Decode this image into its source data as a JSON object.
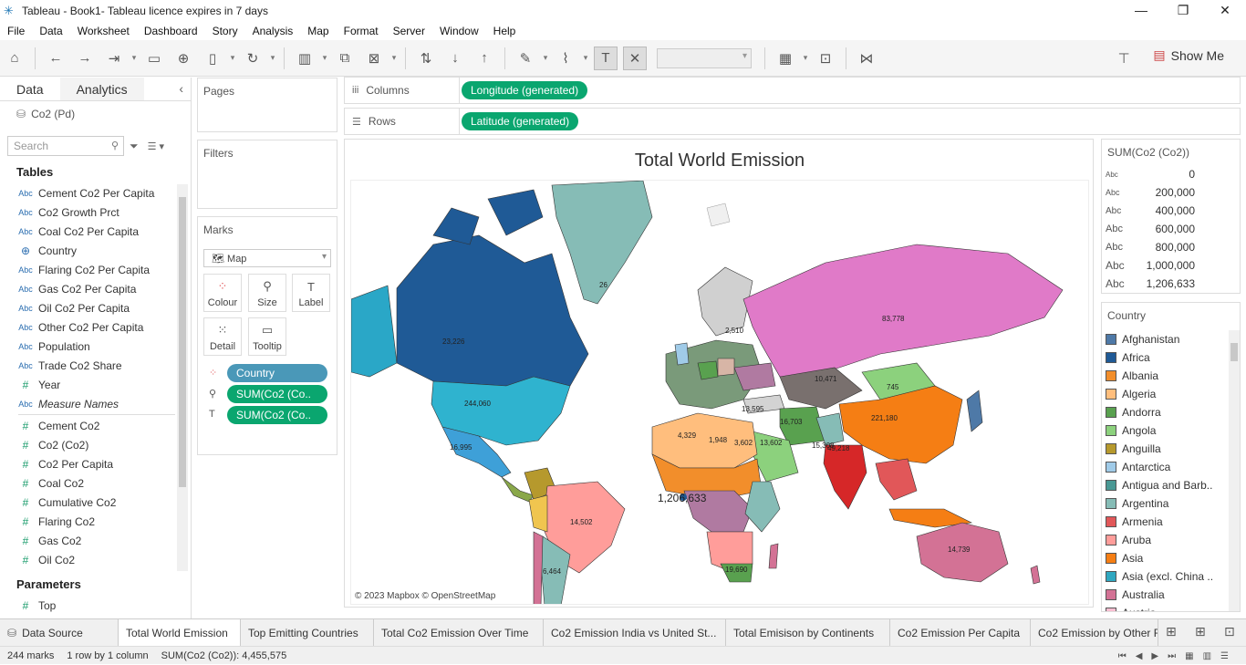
{
  "window": {
    "title": "Tableau - Book1- Tableau licence expires in 7 days",
    "min": "—",
    "restore": "❐",
    "close": "✕"
  },
  "menu": [
    "File",
    "Data",
    "Worksheet",
    "Dashboard",
    "Story",
    "Analysis",
    "Map",
    "Format",
    "Server",
    "Window",
    "Help"
  ],
  "toolbar": {
    "show_me": "Show Me"
  },
  "data_pane": {
    "tab_data": "Data",
    "tab_analytics": "Analytics",
    "datasource": "Co2 (Pd)",
    "search_placeholder": "Search",
    "tables_title": "Tables",
    "dimensions": [
      {
        "type": "Abc",
        "name": "Cement Co2 Per Capita"
      },
      {
        "type": "Abc",
        "name": "Co2 Growth Prct"
      },
      {
        "type": "Abc",
        "name": "Coal Co2 Per Capita"
      },
      {
        "type": "geo",
        "name": "Country"
      },
      {
        "type": "Abc",
        "name": "Flaring Co2 Per Capita"
      },
      {
        "type": "Abc",
        "name": "Gas Co2 Per Capita"
      },
      {
        "type": "Abc",
        "name": "Oil Co2 Per Capita"
      },
      {
        "type": "Abc",
        "name": "Other Co2 Per Capita"
      },
      {
        "type": "Abc",
        "name": "Population"
      },
      {
        "type": "Abc",
        "name": "Trade Co2 Share"
      },
      {
        "type": "#",
        "name": "Year"
      },
      {
        "type": "Abc",
        "name": "Measure Names"
      }
    ],
    "measures": [
      {
        "type": "#",
        "name": "Cement Co2"
      },
      {
        "type": "#",
        "name": "Co2 (Co2)"
      },
      {
        "type": "#",
        "name": "Co2 Per Capita"
      },
      {
        "type": "#",
        "name": "Coal Co2"
      },
      {
        "type": "#",
        "name": "Cumulative Co2"
      },
      {
        "type": "#",
        "name": "Flaring Co2"
      },
      {
        "type": "#",
        "name": "Gas Co2"
      },
      {
        "type": "#",
        "name": "Oil Co2"
      }
    ],
    "parameters_title": "Parameters",
    "parameters": [
      {
        "type": "#",
        "name": "Top"
      }
    ]
  },
  "cards": {
    "pages": "Pages",
    "filters": "Filters",
    "marks": "Marks",
    "mark_type": "Map",
    "buttons": {
      "colour": "Colour",
      "size": "Size",
      "label": "Label",
      "detail": "Detail",
      "tooltip": "Tooltip"
    },
    "pills": [
      "Country",
      "SUM(Co2 (Co..",
      "SUM(Co2 (Co.."
    ]
  },
  "shelves": {
    "columns_label": "Columns",
    "columns_pill": "Longitude (generated)",
    "rows_label": "Rows",
    "rows_pill": "Latitude (generated)"
  },
  "viz": {
    "title": "Total World Emission",
    "copyright": "© 2023 Mapbox © OpenStreetMap",
    "labels": {
      "greenland": "26",
      "canada": "23,226",
      "usa": "244,060",
      "russia": "83,778",
      "china": "221,180",
      "india": "49,218",
      "brazil": "14,502",
      "australia": "14,739",
      "kazakh": "10,471",
      "mongolia": "745",
      "center": "1,206,633",
      "mexico": "16,995",
      "iran": "16,703",
      "saudi": "13,602",
      "pakistan": "15,308",
      "southafrica": "19,690",
      "argentina": "6,464",
      "ukraine": "13,595",
      "poland": "2,510",
      "algeria": "4,329",
      "libya": "1,948",
      "egypt": "3,602"
    }
  },
  "size_legend": {
    "title": "SUM(Co2 (Co2))",
    "rows": [
      {
        "abc": "Abc",
        "value": "0"
      },
      {
        "abc": "Abc",
        "value": "200,000"
      },
      {
        "abc": "Abc",
        "value": "400,000"
      },
      {
        "abc": "Abc",
        "value": "600,000"
      },
      {
        "abc": "Abc",
        "value": "800,000"
      },
      {
        "abc": "Abc",
        "value": "1,000,000"
      },
      {
        "abc": "Abc",
        "value": "1,206,633"
      }
    ]
  },
  "color_legend": {
    "title": "Country",
    "items": [
      {
        "name": "Afghanistan",
        "color": "#4e79a7"
      },
      {
        "name": "Africa",
        "color": "#1f5a96"
      },
      {
        "name": "Albania",
        "color": "#f28e2b"
      },
      {
        "name": "Algeria",
        "color": "#ffbe7d"
      },
      {
        "name": "Andorra",
        "color": "#59a14f"
      },
      {
        "name": "Angola",
        "color": "#8cd17d"
      },
      {
        "name": "Anguilla",
        "color": "#b6992d"
      },
      {
        "name": "Antarctica",
        "color": "#a0cbe8"
      },
      {
        "name": "Antigua and Barb..",
        "color": "#499894"
      },
      {
        "name": "Argentina",
        "color": "#86bcb6"
      },
      {
        "name": "Armenia",
        "color": "#e15759"
      },
      {
        "name": "Aruba",
        "color": "#ff9d9a"
      },
      {
        "name": "Asia",
        "color": "#f57e14"
      },
      {
        "name": "Asia (excl. China ..",
        "color": "#2fa7c0"
      },
      {
        "name": "Australia",
        "color": "#d37295"
      },
      {
        "name": "Austria",
        "color": "#fabfd2"
      }
    ]
  },
  "sheet_tabs": {
    "datasource": "Data Source",
    "tabs": [
      "Total World Emission",
      "Top Emitting Countries",
      "Total Co2 Emission Over Time",
      "Co2 Emission India vs United St...",
      "Total Emisison by Continents",
      "Co2 Emission Per Capita",
      "Co2 Emission by Other F"
    ]
  },
  "status": {
    "marks": "244 marks",
    "rows": "1 row by 1 column",
    "sum": "SUM(Co2 (Co2)): 4,455,575"
  }
}
